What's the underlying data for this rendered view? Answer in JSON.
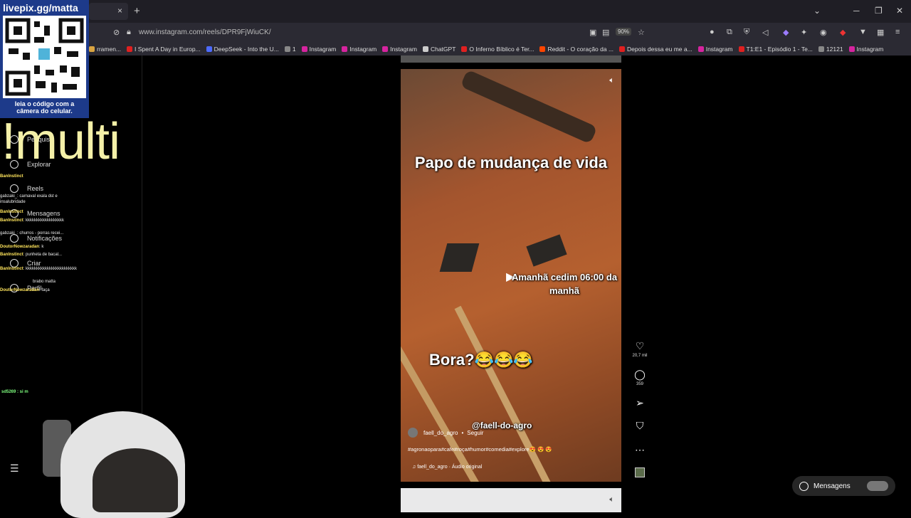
{
  "browser": {
    "url": "www.instagram.com/reels/DPR9FjWiuCK/",
    "zoom": "90%",
    "tab_close": "×",
    "new_tab": "+",
    "bookmarks": [
      {
        "label": "rramen...",
        "color": "#d9a441"
      },
      {
        "label": "I Spent A Day in Europ...",
        "color": "#e02020"
      },
      {
        "label": "DeepSeek - Into the U...",
        "color": "#4d6bfe"
      },
      {
        "label": "1",
        "color": "#888888"
      },
      {
        "label": "Instagram",
        "color": "#d6249f"
      },
      {
        "label": "Instagram",
        "color": "#d6249f"
      },
      {
        "label": "Instagram",
        "color": "#d6249f"
      },
      {
        "label": "ChatGPT",
        "color": "#cccccc"
      },
      {
        "label": "O Inferno Bíblico é Ter...",
        "color": "#e02020"
      },
      {
        "label": "Reddit - O coração da ...",
        "color": "#ff4500"
      },
      {
        "label": "Depois dessa eu me a...",
        "color": "#e02020"
      },
      {
        "label": "Instagram",
        "color": "#d6249f"
      },
      {
        "label": "T1:E1 - Episódio 1 - Te...",
        "color": "#e02020"
      },
      {
        "label": "12121",
        "color": "#888888"
      },
      {
        "label": "Instagram",
        "color": "#d6249f"
      }
    ]
  },
  "overlay": {
    "qr_title": "livepix.gg/matta",
    "qr_caption": "leia o código com a câmera do celular.",
    "multi": "!multi",
    "cam_user": "sd5269 : si m"
  },
  "ig_sidebar": {
    "items": [
      "Pesquisa",
      "Explorar",
      "Reels",
      "Mensagens",
      "Notificações",
      "Criar",
      "Perfil"
    ]
  },
  "chat": [
    {
      "user": "BanInstinct",
      "msg": ""
    },
    {
      "user": "gabzaki_",
      "msg": ": carnaval exala dst e insalubridade"
    },
    {
      "user": "BanInstinct",
      "msg": ""
    },
    {
      "user": "BanInstinct",
      "msg": ": kkkkkkkkkkkkkkkkkk"
    },
    {
      "user": "gabzaki_",
      "msg": ": churros - porras recei..."
    },
    {
      "user": "DoutorNowzaradan",
      "msg": ": k"
    },
    {
      "user": "BanInstinct",
      "msg": ": punheta de bacal..."
    },
    {
      "user": "BanInstinct",
      "msg": ": kkkkkkkkkkkkkkkkkkkkkkkk"
    },
    {
      "user": "",
      "msg": "brabo matta"
    },
    {
      "user": "DoutorNowzaradan",
      "msg": ": faça"
    }
  ],
  "reel": {
    "title": "Papo de mudança de vida",
    "mid": "Amanhã cedim 06:00 da manhã",
    "bora": "Bora?😂😂😂",
    "handle": "@faell-do-agro",
    "author": "faell_do_agro",
    "follow": "Seguir",
    "tags": "#agronaopara#cafe#roça#humor#comedia#explore😍 😍 😍",
    "audio": "faell_do_agro · Áudio original"
  },
  "actions": {
    "likes": "20,7 mil",
    "comments": "359"
  },
  "messages_button": "Mensagens"
}
